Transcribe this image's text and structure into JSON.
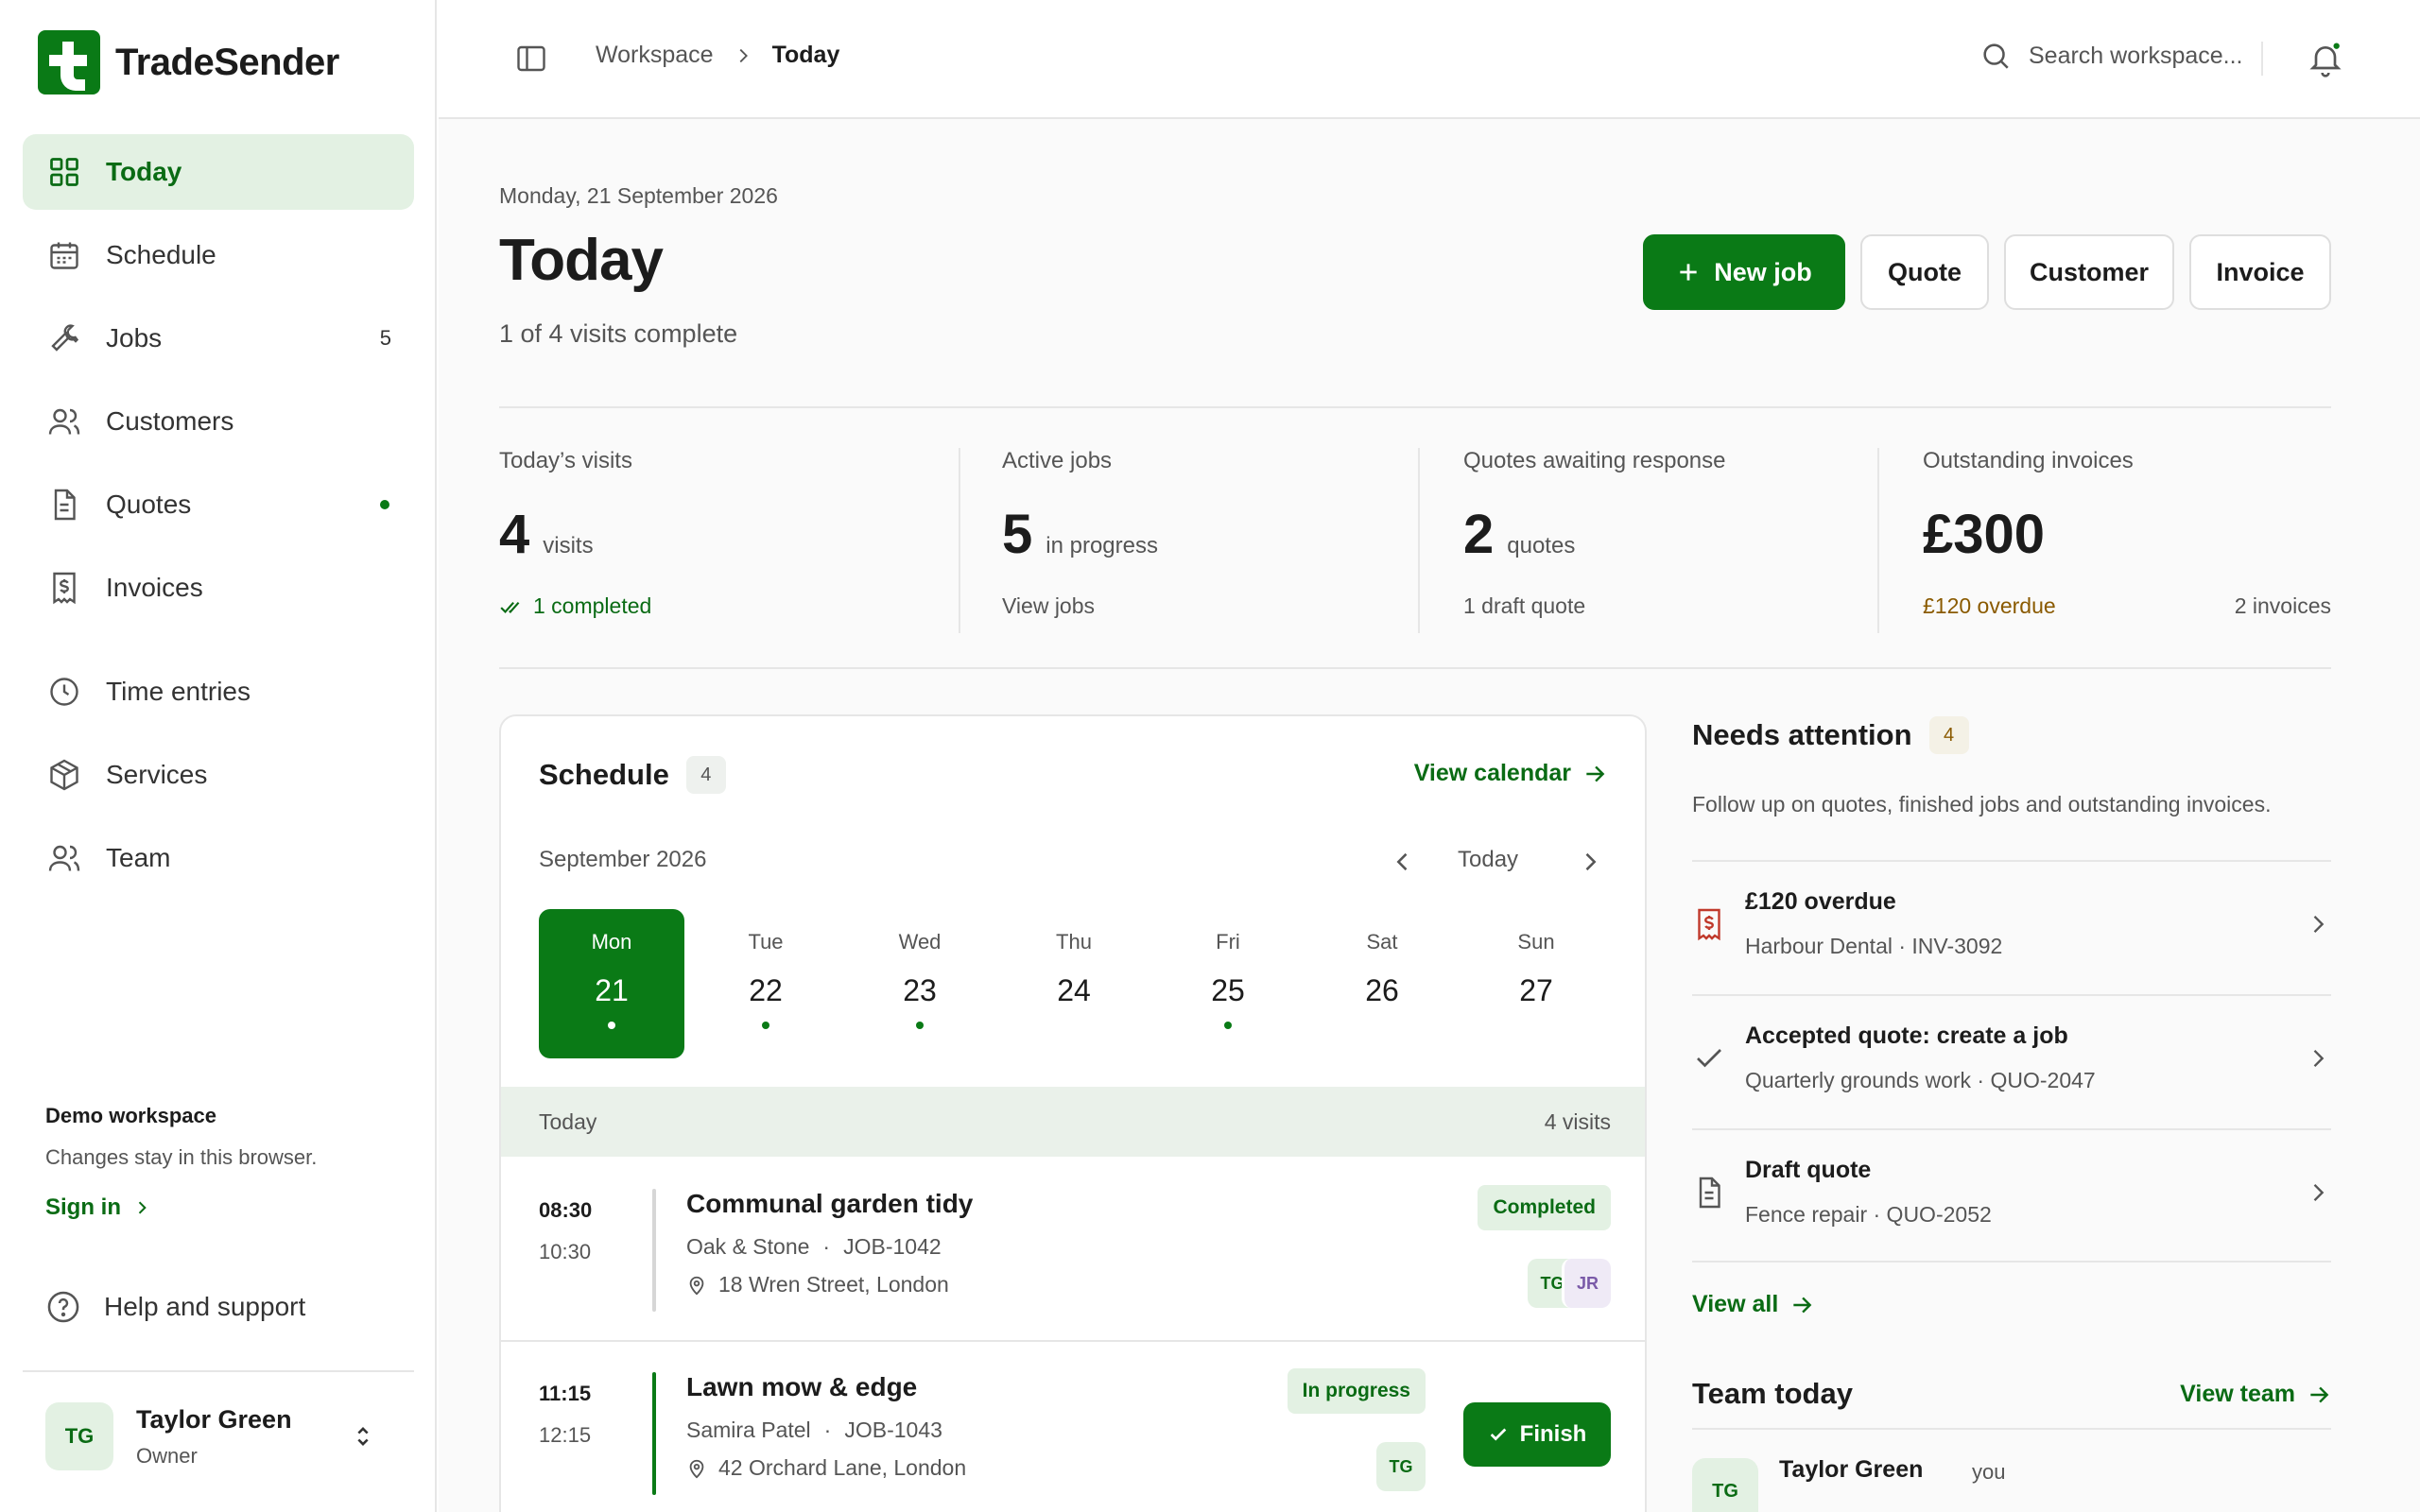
{
  "app": {
    "name": "TradeSender"
  },
  "sidebar": {
    "items": [
      {
        "label": "Today",
        "icon": "grid-icon"
      },
      {
        "label": "Schedule",
        "icon": "calendar-icon"
      },
      {
        "label": "Jobs",
        "icon": "wrench-icon",
        "count": "5"
      },
      {
        "label": "Customers",
        "icon": "users-icon"
      },
      {
        "label": "Quotes",
        "icon": "document-icon"
      },
      {
        "label": "Invoices",
        "icon": "receipt-icon"
      },
      {
        "label": "Time entries",
        "icon": "clock-icon"
      },
      {
        "label": "Services",
        "icon": "box-icon"
      },
      {
        "label": "Team",
        "icon": "team-icon"
      }
    ],
    "demo": {
      "title": "Demo workspace",
      "description": "Changes stay in this browser.",
      "sign_in": "Sign in"
    },
    "help": "Help and support",
    "user": {
      "initials": "TG",
      "name": "Taylor Green",
      "role": "Owner"
    }
  },
  "topbar": {
    "breadcrumb": [
      "Workspace",
      "Today"
    ],
    "search_placeholder": "Search workspace..."
  },
  "header": {
    "date": "Monday, 21 September 2026",
    "title": "Today",
    "subtitle": "1 of 4 visits complete",
    "actions": {
      "new_job": "New job",
      "quote": "Quote",
      "customer": "Customer",
      "invoice": "Invoice"
    }
  },
  "stats": [
    {
      "label": "Today’s visits",
      "value": "4",
      "unit": "visits",
      "foot": "1 completed"
    },
    {
      "label": "Active jobs",
      "value": "5",
      "unit": "in progress",
      "foot": "View jobs"
    },
    {
      "label": "Quotes awaiting response",
      "value": "2",
      "unit": "quotes",
      "foot": "1 draft quote"
    },
    {
      "label": "Outstanding invoices",
      "value": "£300",
      "unit": "",
      "foot": "£120 overdue",
      "foot_right": "2 invoices"
    }
  ],
  "schedule": {
    "title": "Schedule",
    "count": "4",
    "view_calendar": "View calendar",
    "month": "September 2026",
    "today_button": "Today",
    "days": [
      {
        "name": "Mon",
        "date": "21",
        "dot": true,
        "selected": true
      },
      {
        "name": "Tue",
        "date": "22",
        "dot": true
      },
      {
        "name": "Wed",
        "date": "23",
        "dot": true
      },
      {
        "name": "Thu",
        "date": "24",
        "dot": false
      },
      {
        "name": "Fri",
        "date": "25",
        "dot": true
      },
      {
        "name": "Sat",
        "date": "26",
        "dot": false
      },
      {
        "name": "Sun",
        "date": "27",
        "dot": false
      }
    ],
    "section_label": "Today",
    "section_count": "4 visits",
    "visits": [
      {
        "start": "08:30",
        "end": "10:30",
        "title": "Communal garden tidy",
        "customer": "Oak & Stone",
        "job": "JOB-1042",
        "address": "18 Wren Street, London",
        "status": "Completed",
        "assignees": [
          "TG",
          "JR"
        ]
      },
      {
        "start": "11:15",
        "end": "12:15",
        "title": "Lawn mow & edge",
        "customer": "Samira Patel",
        "job": "JOB-1043",
        "address": "42 Orchard Lane, London",
        "status": "In progress",
        "assignees": [
          "TG"
        ],
        "action": "Finish"
      }
    ]
  },
  "attention": {
    "title": "Needs attention",
    "count": "4",
    "description": "Follow up on quotes, finished jobs and outstanding invoices.",
    "items": [
      {
        "title": "£120 overdue",
        "subtitle": "Harbour Dental · INV-3092",
        "icon": "invoice-icon"
      },
      {
        "title": "Accepted quote: create a job",
        "subtitle": "Quarterly grounds work · QUO-2047",
        "icon": "check-icon"
      },
      {
        "title": "Draft quote",
        "subtitle": "Fence repair · QUO-2052",
        "icon": "document-icon"
      }
    ],
    "view_all": "View all"
  },
  "team": {
    "title": "Team today",
    "view_team": "View team",
    "members": [
      {
        "initials": "TG",
        "name": "Taylor Green",
        "tag": "you"
      }
    ]
  },
  "colors": {
    "accent": "#0a7a16",
    "accent_light": "#e3f1e3",
    "overdue": "#8a5a00",
    "danger": "#c0392b"
  }
}
